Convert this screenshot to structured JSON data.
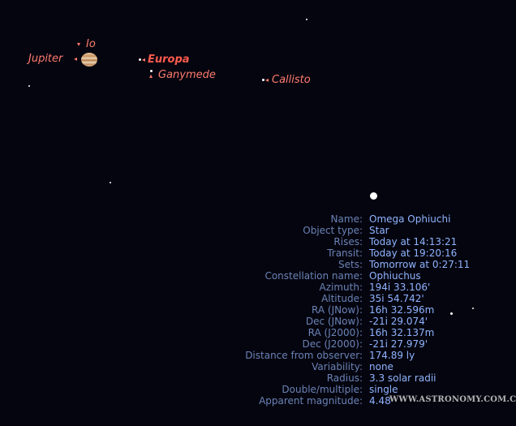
{
  "sky": {
    "bodies": {
      "jupiter": "Jupiter",
      "io": "Io",
      "europa": "Europa",
      "ganymede": "Ganymede",
      "callisto": "Callisto"
    }
  },
  "info": {
    "rows": [
      {
        "label": "Name:",
        "value": "Omega Ophiuchi"
      },
      {
        "label": "Object type:",
        "value": "Star"
      },
      {
        "label": "Rises:",
        "value": "Today at 14:13:21"
      },
      {
        "label": "Transit:",
        "value": "Today at 19:20:16"
      },
      {
        "label": "Sets:",
        "value": "Tomorrow at 0:27:11"
      },
      {
        "label": "Constellation name:",
        "value": "Ophiuchus"
      },
      {
        "label": "Azimuth:",
        "value": "194i  33.106'"
      },
      {
        "label": "Altitude:",
        "value": "35i  54.742'"
      },
      {
        "label": "RA (JNow):",
        "value": "16h 32.596m"
      },
      {
        "label": "Dec (JNow):",
        "value": "-21i  29.074'"
      },
      {
        "label": "RA (J2000):",
        "value": "16h 32.137m"
      },
      {
        "label": "Dec (J2000):",
        "value": "-21i  27.979'"
      },
      {
        "label": "Distance from observer:",
        "value": "174.89 ly"
      },
      {
        "label": "Variability:",
        "value": "none"
      },
      {
        "label": "Radius:",
        "value": "3.3 solar radii"
      },
      {
        "label": "Double/multiple:",
        "value": "single"
      },
      {
        "label": "Apparent magnitude:",
        "value": "4.48"
      }
    ]
  },
  "watermark": "WWW.ASTRONOMY.COM.CN",
  "colors": {
    "background": "#05050f",
    "label_name": "#6a83b6",
    "label_value": "#8fb4ff",
    "moon_label": "#ff7b6e"
  }
}
